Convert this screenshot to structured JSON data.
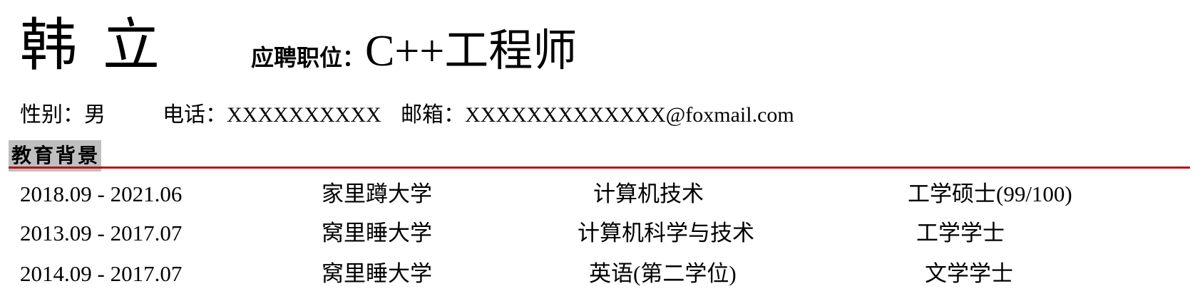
{
  "header": {
    "name": "韩立",
    "position_label": "应聘职位：",
    "position_value": "C++工程师"
  },
  "contact": {
    "gender": "性别：男",
    "phone": "电话：XXXXXXXXXX",
    "email": "邮箱：XXXXXXXXXXXXX@foxmail.com"
  },
  "education": {
    "section_title": "教育背景",
    "accent_color": "#b3151b",
    "header_bg": "#bfbfbf",
    "rows": [
      {
        "dates": "2018.09 - 2021.06",
        "school": "家里蹲大学",
        "major": "计算机技术",
        "degree": "工学硕士(99/100)"
      },
      {
        "dates": "2013.09 - 2017.07",
        "school": "窝里睡大学",
        "major": "计算机科学与技术",
        "degree": "工学学士"
      },
      {
        "dates": "2014.09 - 2017.07",
        "school": "窝里睡大学",
        "major": "英语(第二学位)",
        "degree": "文学学士"
      }
    ]
  }
}
